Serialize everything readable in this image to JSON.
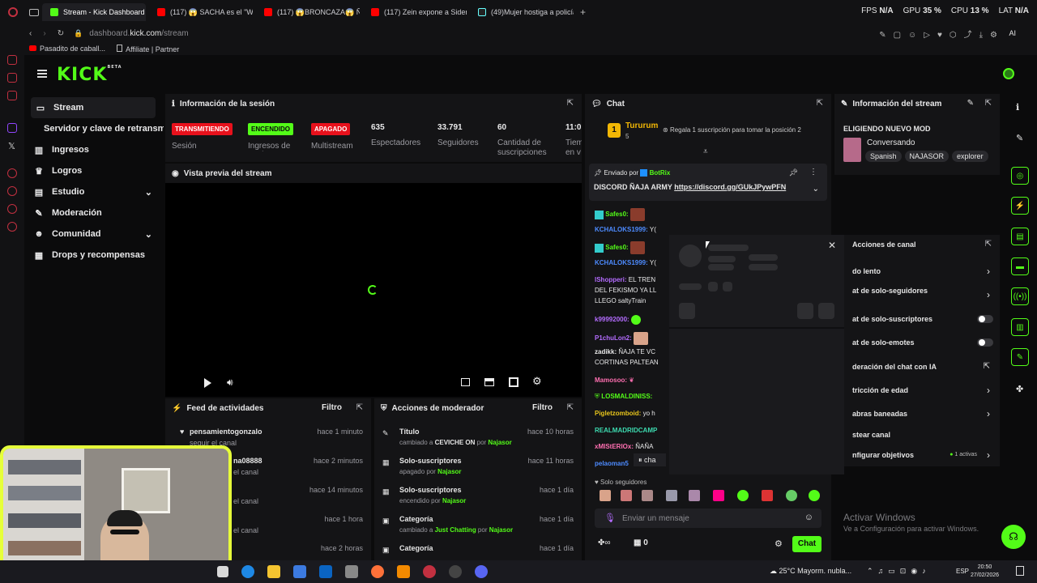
{
  "browser": {
    "tabs": [
      {
        "label": "Stream - Kick Dashboard",
        "active": true
      },
      {
        "label": "(117) 😱 SACHA es el \"WE"
      },
      {
        "label": "(117) 😱BRONCAZA😱 ÑA"
      },
      {
        "label": "(117) Zein expone a Sidera"
      },
      {
        "label": "(49)Mujer hostiga a policía"
      }
    ],
    "new_tab": "+",
    "url_host": "dashboard.",
    "url_domain": "kick.com",
    "url_path": "/stream",
    "bookmarks": [
      "Pasadito de caball...",
      "Affiliate | Partner"
    ],
    "sys": {
      "fps_label": "FPS",
      "fps_val": "N/A",
      "gpu_label": "GPU",
      "gpu_val": "35 %",
      "cpu_label": "CPU",
      "cpu_val": "13 %",
      "lat_label": "LAT",
      "lat_val": "N/A"
    },
    "ai_label": "AI"
  },
  "kick": {
    "logo": "KICK",
    "logo_sup": "BETA",
    "nav": [
      {
        "label": "Stream",
        "icon": "video-icon",
        "active": true
      },
      {
        "label": "Servidor y clave de retransmisión"
      },
      {
        "label": "Ingresos",
        "icon": "bars-icon"
      },
      {
        "label": "Logros",
        "icon": "trophy-icon"
      },
      {
        "label": "Estudio",
        "icon": "studio-icon",
        "expand": true
      },
      {
        "label": "Moderación",
        "icon": "wrench-icon"
      },
      {
        "label": "Comunidad",
        "icon": "people-icon",
        "expand": true
      },
      {
        "label": "Drops y recompensas",
        "icon": "gift-icon"
      }
    ]
  },
  "session": {
    "title": "Información de la sesión",
    "badges": [
      {
        "label": "TRANSMITIENDO",
        "caption": "Sesión"
      },
      {
        "label": "ENCENDIDO",
        "caption": "Ingresos de Socio"
      },
      {
        "label": "APAGADO",
        "caption": "Multistream"
      }
    ],
    "stats": [
      {
        "value": "635",
        "label": "Espectadores"
      },
      {
        "value": "33.791",
        "label": "Seguidores"
      },
      {
        "value": "60",
        "label": "Cantidad de suscripciones"
      },
      {
        "value": "11:0",
        "label": "Tiem en v"
      }
    ]
  },
  "preview": {
    "title": "Vista previa del stream"
  },
  "activity": {
    "title": "Feed de actividades",
    "filter": "Filtro",
    "rows": [
      {
        "name": "pensamientogonzalo",
        "sub": "seguir el canal",
        "time": "hace 1 minuto"
      },
      {
        "name": "na08888",
        "sub": "el canal",
        "time": "hace 2 minutos"
      },
      {
        "name": "",
        "sub": "el canal",
        "time": "hace 14 minutos"
      },
      {
        "name": "",
        "sub": "el canal",
        "time": "hace 1 hora"
      },
      {
        "name": "",
        "sub": "el canal",
        "time": "hace 2 horas"
      }
    ]
  },
  "modactions": {
    "title": "Acciones de moderador",
    "filter": "Filtro",
    "rows": [
      {
        "title": "Título",
        "pre": "cambiado a ",
        "bold": "CEVICHE ON",
        "by": " por ",
        "user": "Najasor",
        "time": "hace 10 horas"
      },
      {
        "title": "Solo-suscriptores",
        "pre": "apagado",
        "bold": "",
        "by": " por ",
        "user": "Najasor",
        "time": "hace 11 horas"
      },
      {
        "title": "Solo-suscriptores",
        "pre": "encendido",
        "bold": "",
        "by": " por ",
        "user": "Najasor",
        "time": "hace 1 día"
      },
      {
        "title": "Categoría",
        "pre": "cambiado a ",
        "bold": "Just Chatting",
        "by": " por ",
        "user": "Najasor",
        "time": "hace 1 día"
      },
      {
        "title": "Categoría",
        "pre": "",
        "bold": "",
        "by": "",
        "user": "",
        "time": "hace 1 día"
      }
    ]
  },
  "chat": {
    "title": "Chat",
    "top_user": "Tururum",
    "top_rank": "1",
    "top_count": "5",
    "gift_text": "Regala 1 suscripción para tomar la posición 2",
    "pinned_by_label": "Enviado por",
    "pinned_by_user": "BotRix",
    "pinned_text": "DISCORD ÑAJA ARMY",
    "pinned_link": "https://discord.gg/GUkJPywPFN",
    "messages": [
      {
        "user": "Safes0:",
        "text": "",
        "color": "#53fc18"
      },
      {
        "user": "KCHALOKS1999:",
        "text": "Y(",
        "color": "#4d8bff"
      },
      {
        "user": "Safes0:",
        "text": "",
        "color": "#53fc18"
      },
      {
        "user": "KCHALOKS1999:",
        "text": "Y(",
        "color": "#4d8bff"
      },
      {
        "user": "lShopperi:",
        "text": "EL TREN",
        "color": "#b46cff"
      },
      {
        "user": "",
        "text": "DEL FEKISMO YA LL",
        "color": ""
      },
      {
        "user": "",
        "text": "LLEGO saltyTrain",
        "color": ""
      },
      {
        "user": "k99992000:",
        "text": "",
        "color": "#b46cff"
      },
      {
        "user": "P1chuLon2:",
        "text": "",
        "color": "#b46cff"
      },
      {
        "user": "zadikk:",
        "text": "ÑAJA TE VC",
        "color": "#e9e9ea"
      },
      {
        "user": "",
        "text": "CORTINAS PALTEAN",
        "color": ""
      },
      {
        "user": "Mamosoo:",
        "text": "",
        "color": "#ff6fb1"
      },
      {
        "user": "LOSMALDINISS:",
        "text": "",
        "color": "#53fc18"
      },
      {
        "user": "Pigletzomboid:",
        "text": "yo h",
        "color": "#e8c51c"
      },
      {
        "user": "REALMADRIDCAMP",
        "text": "",
        "color": "#3ddbb0"
      },
      {
        "user": "xMIStERIOx:",
        "text": "ÑAÑA",
        "color": "#ff6fb1"
      },
      {
        "user": "pelaoman5",
        "text": "",
        "color": "#4d8bff"
      }
    ],
    "paused_label": "cha",
    "followers_only": "Solo seguidores",
    "input_placeholder": "Enviar un mensaje",
    "points": "0",
    "send_label": "Chat"
  },
  "streaminfo": {
    "title": "Información del stream",
    "stream_title": "ELIGIENDO NUEVO MOD",
    "category": "Conversando",
    "tags": [
      "Spanish",
      "NAJASOR",
      "explorer"
    ]
  },
  "channelactions": {
    "title": "Acciones de canal",
    "items": [
      {
        "label": "do lento",
        "type": "arrow"
      },
      {
        "label": "at de solo-seguidores",
        "type": "arrow"
      },
      {
        "label": "at de solo-suscriptores",
        "type": "toggle"
      },
      {
        "label": "at de solo-emotes",
        "type": "toggle"
      },
      {
        "label": "deración del chat con IA",
        "type": "external"
      },
      {
        "label": "tricción de edad",
        "type": "arrow"
      },
      {
        "label": "abras baneadas",
        "type": "arrow"
      },
      {
        "label": "stear canal",
        "type": "none"
      },
      {
        "label": "nfigurar objetivos",
        "type": "arrow",
        "extra": "1 activas"
      }
    ]
  },
  "windows": {
    "activate_title": "Activar Windows",
    "activate_sub": "Ve a Configuración para activar Windows.",
    "weather": "25°C  Mayorm. nubla...",
    "lang": "ESP",
    "time": "20:50",
    "date": "27/02/2026"
  }
}
